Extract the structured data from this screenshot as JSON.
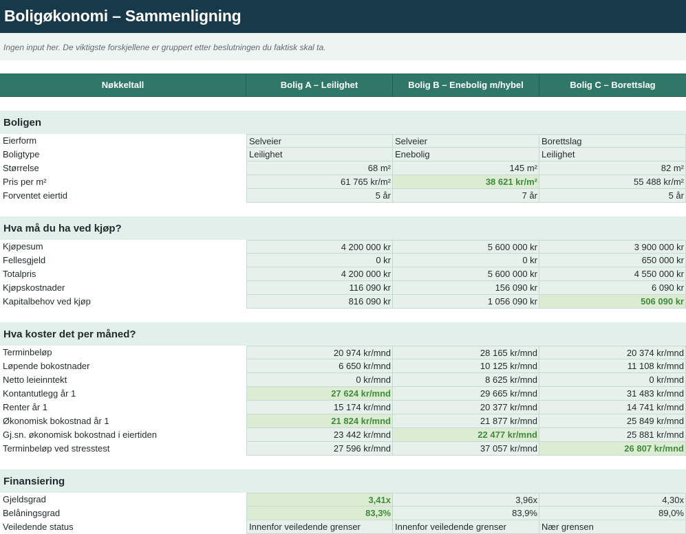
{
  "title": "Boligøkonomi – Sammenligning",
  "subtitle": "Ingen input her. De viktigste forskjellene er gruppert etter beslutningen du faktisk skal ta.",
  "columns": [
    "Nøkkeltall",
    "Bolig A – Leilighet",
    "Bolig B – Enebolig m/hybel",
    "Bolig C – Borettslag"
  ],
  "colors": {
    "title_bg": "#17394a",
    "header_bg": "#2f7767",
    "section_bg": "#e3efea",
    "cell_bg": "#e6f1ec",
    "best_bg": "#dcecd2",
    "best_text": "#3f8a3f"
  },
  "sections": [
    {
      "title": "Boligen",
      "rows": [
        {
          "label": "Eierform",
          "align": "left",
          "values": [
            "Selveier",
            "Selveier",
            "Borettslag"
          ],
          "best": []
        },
        {
          "label": "Boligtype",
          "align": "left",
          "values": [
            "Leilighet",
            "Enebolig",
            "Leilighet"
          ],
          "best": []
        },
        {
          "label": "Størrelse",
          "align": "right",
          "values": [
            "68 m²",
            "145 m²",
            "82 m²"
          ],
          "best": []
        },
        {
          "label": "Pris per m²",
          "align": "right",
          "values": [
            "61 765 kr/m²",
            "38 621 kr/m²",
            "55 488 kr/m²"
          ],
          "best": [
            1
          ]
        },
        {
          "label": "Forventet eiertid",
          "align": "right",
          "values": [
            "5 år",
            "7 år",
            "5 år"
          ],
          "best": []
        }
      ]
    },
    {
      "title": "Hva må du ha ved kjøp?",
      "rows": [
        {
          "label": "Kjøpesum",
          "align": "right",
          "values": [
            "4 200 000 kr",
            "5 600 000 kr",
            "3 900 000 kr"
          ],
          "best": []
        },
        {
          "label": "Fellesgjeld",
          "align": "right",
          "values": [
            "0 kr",
            "0 kr",
            "650 000 kr"
          ],
          "best": []
        },
        {
          "label": "Totalpris",
          "align": "right",
          "values": [
            "4 200 000 kr",
            "5 600 000 kr",
            "4 550 000 kr"
          ],
          "best": []
        },
        {
          "label": "Kjøpskostnader",
          "align": "right",
          "values": [
            "116 090 kr",
            "156 090 kr",
            "6 090 kr"
          ],
          "best": []
        },
        {
          "label": "Kapitalbehov ved kjøp",
          "align": "right",
          "values": [
            "816 090 kr",
            "1 056 090 kr",
            "506 090 kr"
          ],
          "best": [
            2
          ]
        }
      ]
    },
    {
      "title": "Hva koster det per måned?",
      "rows": [
        {
          "label": "Terminbeløp",
          "align": "right",
          "values": [
            "20 974 kr/mnd",
            "28 165 kr/mnd",
            "20 374 kr/mnd"
          ],
          "best": []
        },
        {
          "label": "Løpende bokostnader",
          "align": "right",
          "values": [
            "6 650 kr/mnd",
            "10 125 kr/mnd",
            "11 108 kr/mnd"
          ],
          "best": []
        },
        {
          "label": "Netto leieinntekt",
          "align": "right",
          "values": [
            "0 kr/mnd",
            "8 625 kr/mnd",
            "0 kr/mnd"
          ],
          "best": []
        },
        {
          "label": "Kontantutlegg år 1",
          "align": "right",
          "values": [
            "27 624 kr/mnd",
            "29 665 kr/mnd",
            "31 483 kr/mnd"
          ],
          "best": [
            0
          ]
        },
        {
          "label": "Renter år 1",
          "align": "right",
          "values": [
            "15 174 kr/mnd",
            "20 377 kr/mnd",
            "14 741 kr/mnd"
          ],
          "best": []
        },
        {
          "label": "Økonomisk bokostnad år 1",
          "align": "right",
          "values": [
            "21 824 kr/mnd",
            "21 877 kr/mnd",
            "25 849 kr/mnd"
          ],
          "best": [
            0
          ]
        },
        {
          "label": "Gj.sn. økonomisk bokostnad i eiertiden",
          "align": "right",
          "values": [
            "23 442 kr/mnd",
            "22 477 kr/mnd",
            "25 881 kr/mnd"
          ],
          "best": [
            1
          ]
        },
        {
          "label": "Terminbeløp ved stresstest",
          "align": "right",
          "values": [
            "27 596 kr/mnd",
            "37 057 kr/mnd",
            "26 807 kr/mnd"
          ],
          "best": [
            2
          ]
        }
      ]
    },
    {
      "title": "Finansiering",
      "rows": [
        {
          "label": "Gjeldsgrad",
          "align": "right",
          "values": [
            "3,41x",
            "3,96x",
            "4,30x"
          ],
          "best": [
            0
          ]
        },
        {
          "label": "Belåningsgrad",
          "align": "right",
          "values": [
            "83,3%",
            "83,9%",
            "89,0%"
          ],
          "best": [
            0
          ]
        },
        {
          "label": "Veiledende status",
          "align": "left",
          "values": [
            "Innenfor veiledende grenser",
            "Innenfor veiledende grenser",
            "Nær grensen"
          ],
          "best": []
        }
      ]
    }
  ]
}
